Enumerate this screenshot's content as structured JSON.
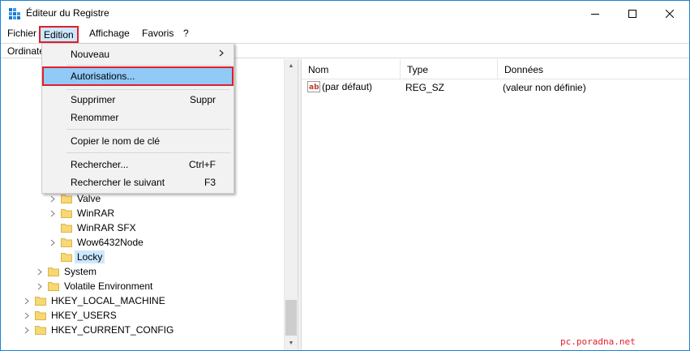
{
  "window": {
    "title": "Éditeur du Registre"
  },
  "menubar": {
    "items": [
      "Fichier",
      "Edition",
      "Affichage",
      "Favoris",
      "?"
    ]
  },
  "address": {
    "text": "Ordinateur"
  },
  "tree": {
    "rows": [
      {
        "label": "Valve",
        "indent": 1,
        "expandable": true
      },
      {
        "label": "WinRAR",
        "indent": 1,
        "expandable": true
      },
      {
        "label": "WinRAR SFX",
        "indent": 1,
        "expandable": false
      },
      {
        "label": "Wow6432Node",
        "indent": 1,
        "expandable": true
      },
      {
        "label": "Locky",
        "indent": 1,
        "expandable": false,
        "selected": true
      },
      {
        "label": "System",
        "indent": 0,
        "expandable": true
      },
      {
        "label": "Volatile Environment",
        "indent": 0,
        "expandable": true
      },
      {
        "label": "HKEY_LOCAL_MACHINE",
        "indent": -1,
        "expandable": true
      },
      {
        "label": "HKEY_USERS",
        "indent": -1,
        "expandable": true
      },
      {
        "label": "HKEY_CURRENT_CONFIG",
        "indent": -1,
        "expandable": true
      }
    ]
  },
  "list": {
    "columns": {
      "name": "Nom",
      "type": "Type",
      "data": "Données"
    },
    "rows": [
      {
        "name": "(par défaut)",
        "type": "REG_SZ",
        "data": "(valeur non définie)"
      }
    ]
  },
  "edit_menu": {
    "items": [
      {
        "label": "Nouveau",
        "shortcut": "",
        "submenu": true
      },
      {
        "label": "Autorisations...",
        "shortcut": "",
        "highlighted": true
      },
      {
        "label": "Supprimer",
        "shortcut": "Suppr"
      },
      {
        "label": "Renommer",
        "shortcut": ""
      },
      {
        "label": "Copier le nom de clé",
        "shortcut": ""
      },
      {
        "label": "Rechercher...",
        "shortcut": "Ctrl+F"
      },
      {
        "label": "Rechercher le suivant",
        "shortcut": "F3"
      }
    ]
  },
  "watermark": "pc.poradna.net",
  "colors": {
    "accent": "#1883d7",
    "highlight_border": "#e0202a",
    "menu_hover": "#91c9f7",
    "selection": "#cce8ff",
    "folder": "#f8d775"
  }
}
